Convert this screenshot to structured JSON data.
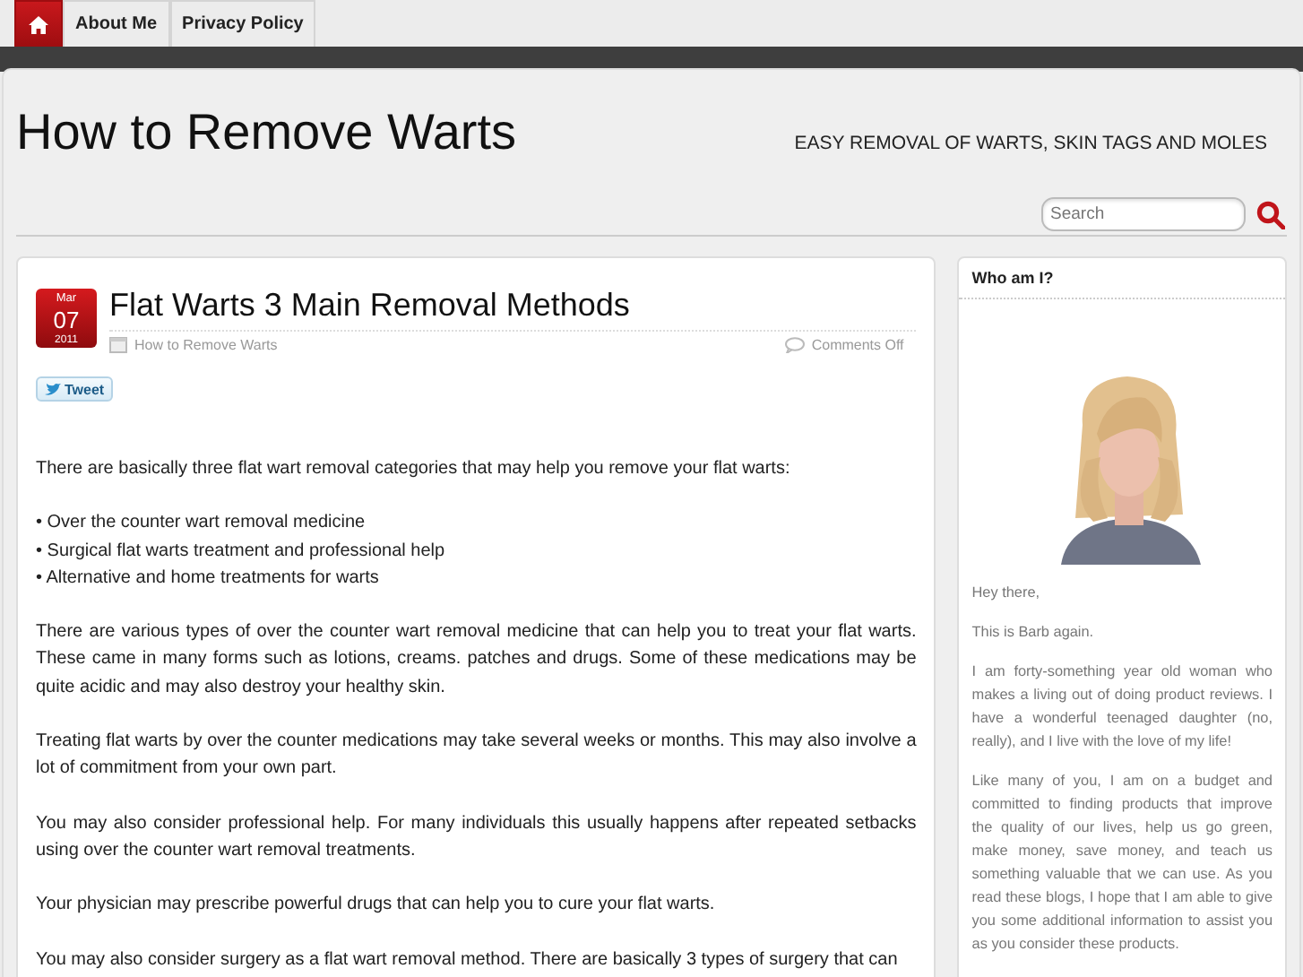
{
  "nav": [
    {
      "kind": "home",
      "selected": true
    },
    {
      "kind": "link",
      "label": "About Me",
      "selected": false
    },
    {
      "kind": "link",
      "label": "Privacy Policy",
      "selected": false
    }
  ],
  "site": {
    "title": "How to Remove Warts",
    "tagline": "EASY REMOVAL OF WARTS, SKIN TAGS AND MOLES"
  },
  "search": {
    "placeholder": "Search"
  },
  "post": {
    "date": {
      "month": "Mar",
      "day": "07",
      "year": "2011"
    },
    "title": "Flat Warts 3 Main Removal Methods",
    "category": "How to Remove Warts",
    "comments": "Comments Off",
    "tweet": "Tweet",
    "blocks": [
      {
        "kind": "para",
        "text": "There are basically three flat wart removal categories that may help you remove your flat warts:"
      },
      {
        "kind": "list",
        "items": [
          "• Over the counter wart removal medicine",
          "• Surgical flat warts treatment and professional help",
          "• Alternative and home treatments for warts"
        ]
      },
      {
        "kind": "para",
        "text": "There are various types of over the counter wart removal medicine that can help you to treat your flat warts. These came in many forms such as lotions, creams. patches and drugs. Some of these medications may be quite acidic and may also destroy your healthy skin."
      },
      {
        "kind": "para",
        "text": "Treating flat warts by over the counter medications may take several weeks or months. This may also involve a lot of commitment from your own part."
      },
      {
        "kind": "para",
        "text": "You may also consider professional help. For many individuals this usually happens after repeated setbacks using over the counter wart removal treatments."
      },
      {
        "kind": "para",
        "text": "Your physician may prescribe powerful drugs that can help you to cure your flat warts."
      },
      {
        "kind": "para",
        "text": "You may also consider surgery as a flat wart removal method. There are basically 3 types of surgery that can"
      }
    ]
  },
  "sidebar": {
    "title": "Who am I?",
    "paragraphs": [
      "Hey there,",
      "This is Barb again.",
      "I am forty-something year old woman who makes a living out of doing product reviews. I have a wonderful teenaged daughter (no, really), and I live with the love of my life!",
      "Like many of you, I am on a budget and committed to finding products that improve the quality of our lives, help us go green, make money, save money, and teach us something valuable that we can use. As you read these blogs, I hope that I am able to give you some additional information to assist you as you consider these products."
    ]
  }
}
